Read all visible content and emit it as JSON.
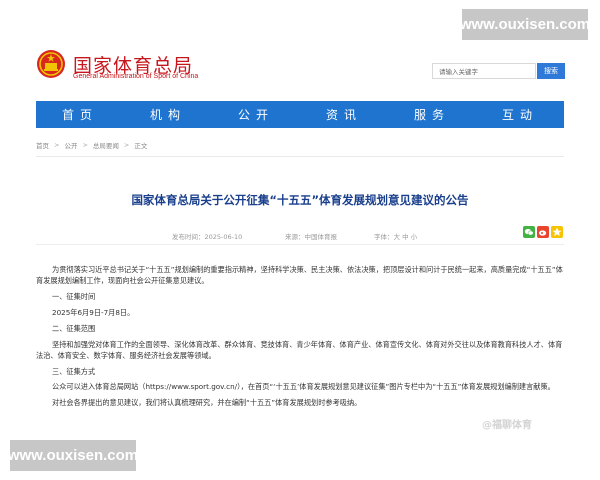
{
  "watermark": "www.ouxisen.com",
  "header": {
    "title": "国家体育总局",
    "subtitle": "General Administration of Sport of China",
    "search": {
      "placeholder": "请输入关键字",
      "button": "搜索"
    }
  },
  "nav": [
    "首页",
    "机构",
    "公开",
    "资讯",
    "服务",
    "互动"
  ],
  "breadcrumb": [
    "首页",
    "公开",
    "总局要闻",
    "正文"
  ],
  "article": {
    "title": "国家体育总局关于公开征集“十五五”体育发展规划意见建议的公告",
    "meta": {
      "date": "发布时间：2025-06-10",
      "source": "来源：中国体育报",
      "font": "字体：大 中 小"
    },
    "paragraphs": [
      "为贯彻落实习近平总书记关于“十五五”规划编制的重要指示精神，坚持科学决策、民主决策、依法决策，把顶层设计和问计于民统一起来，高质量完成“十五五”体育发展规划编制工作，现面向社会公开征集意见建议。",
      "一、征集时间",
      "2025年6月9日-7月8日。",
      "二、征集范围",
      "坚持和加强党对体育工作的全面领导、深化体育改革、群众体育、竞技体育、青少年体育、体育产业、体育宣传文化、体育对外交往以及体育教育科技人才、体育法治、体育安全、数字体育、服务经济社会发展等领域。",
      "三、征集方式",
      "公众可以进入体育总局网站（https://www.sport.gov.cn/），在首页“‘十五五’体育发展规划意见建议征集”图片专栏中为“十五五”体育发展规划编制建言献策。",
      "对社会各界提出的意见建议，我们将认真梳理研究，并在编制“十五五”体育发展规划时参考吸纳。"
    ]
  },
  "source_mark": "@福聊体育",
  "colors": {
    "brand_red": "#c8161d",
    "nav_blue": "#1f74cf",
    "title_blue": "#1a3f8c"
  }
}
